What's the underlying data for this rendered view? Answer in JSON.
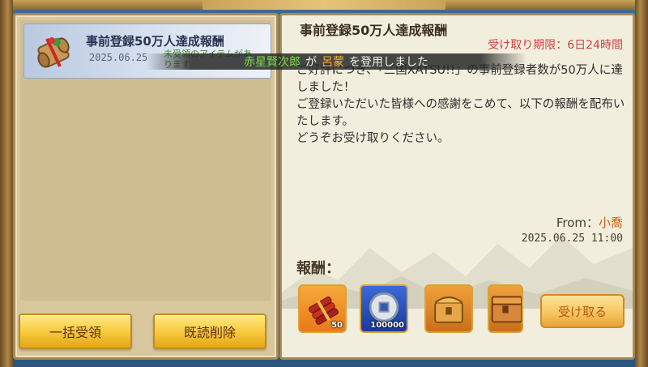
{
  "mail_list": {
    "items": [
      {
        "title": "事前登録50万人達成報酬",
        "date": "2025.06.25",
        "unread_note": "未受領のアイテムがあります",
        "icon": "scroll-gift-icon"
      }
    ]
  },
  "left_buttons": {
    "claim_all": "一括受領",
    "delete_read": "既読削除"
  },
  "mail_detail": {
    "title": "事前登録50万人達成報酬",
    "expiry_label": "受け取り期限：",
    "expiry_value": "6日24時間",
    "body": "ご好評につき、「三国XATSU!!」の事前登録者数が50万人に達しました！\nご登録いただいた皆様への感謝をこめて、以下の報酬を配布いたします。\nどうぞお受け取りください。",
    "from_label": "From：",
    "from_name": "小喬",
    "sent_at": "2025.06.25 11:00",
    "reward_label": "報酬：",
    "rewards": [
      {
        "icon": "firecracker-bundle-icon",
        "qty": "50"
      },
      {
        "icon": "silver-coin-icon",
        "qty": "100000"
      },
      {
        "icon": "gold-chest-icon",
        "qty": ""
      },
      {
        "icon": "treasure-box-icon",
        "qty": ""
      }
    ],
    "receive_button": "受け取る"
  },
  "toast": {
    "player": "赤星賢次郎",
    "particle_ga": "が",
    "general": "呂蒙",
    "suffix": "を登用しました"
  },
  "colors": {
    "accent_gold": "#f7c73a",
    "expiry_red": "#cc4444",
    "from_orange": "#d25a1a",
    "toast_green": "#7ddb4a",
    "toast_orange": "#ffb233"
  }
}
